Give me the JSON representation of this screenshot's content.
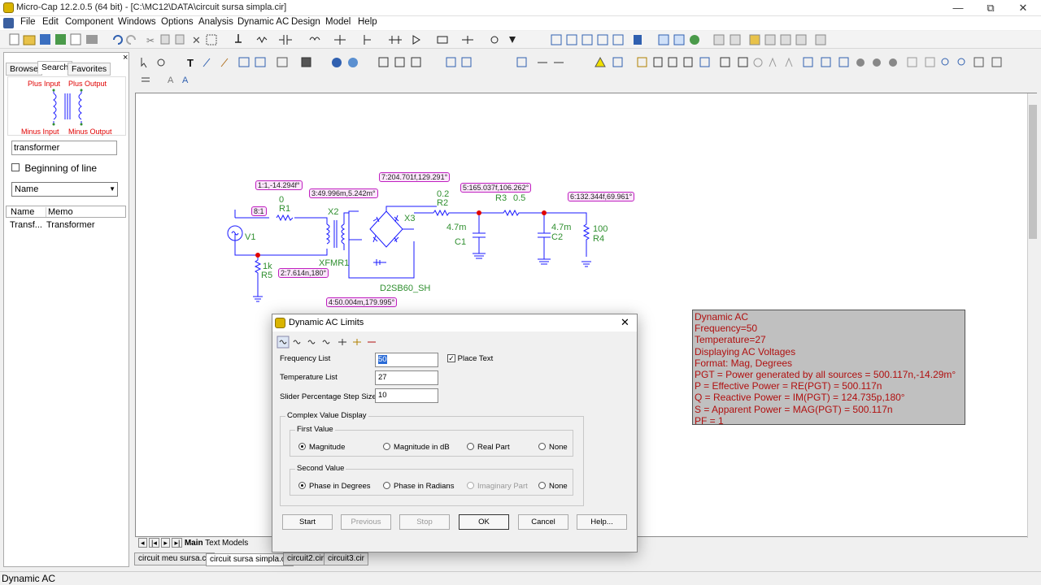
{
  "window": {
    "title": "Micro-Cap 12.2.0.5 (64 bit) - [C:\\MC12\\DATA\\circuit sursa simpla.cir]",
    "controls": [
      "—",
      "⧉",
      "✕"
    ]
  },
  "menu": [
    "File",
    "Edit",
    "Component",
    "Windows",
    "Options",
    "Analysis",
    "Dynamic AC",
    "Design",
    "Model",
    "Help"
  ],
  "panel": {
    "tabs": [
      "Browse",
      "Search",
      "Favorites"
    ],
    "selected_tab": "Search",
    "close": "×",
    "preview_labels": [
      "Plus Input",
      "Plus Output",
      "Minus Input",
      "Minus Output"
    ],
    "search_value": "transformer",
    "beginning_of_line_label": "Beginning of line",
    "filter_select": "Name",
    "columns": [
      "Name",
      "Memo"
    ],
    "rows": [
      {
        "name": "Transf...",
        "memo": "Transformer"
      }
    ]
  },
  "sheet_tabs": [
    "Main",
    "Text",
    "Models"
  ],
  "file_tabs": [
    "circuit meu sursa.cir",
    "circuit sursa simpla.cir",
    "circuit2.cir",
    "circuit3.cir"
  ],
  "selected_file_tab": "circuit sursa simpla.cir",
  "status": "Dynamic AC",
  "schematic": {
    "component_labels": {
      "r1_value": "0",
      "r1": "R1",
      "v1": "V1",
      "x2": "X2",
      "xfmr1": "XFMR1",
      "r5_value": "1k",
      "r5": "R5",
      "x3": "X3",
      "d2sb60": "D2SB60_SH",
      "r2_value": "0.2",
      "r2": "R2",
      "c1_value": "4.7m",
      "c1": "C1",
      "r3": "R3",
      "r3_value": "0.5",
      "c2_value": "4.7m",
      "c2": "C2",
      "r4_value": "100",
      "r4": "R4"
    },
    "node_pills": {
      "n1": "1:1,-14.294f°",
      "n8": "8:1",
      "n3": "3:49.996m,5.242m°",
      "n7": "7:204.701f,129.291°",
      "n5": "5:165.037f,106.262°",
      "n6": "6:132.344f,69.961°",
      "n2": "2:7.614n,180°",
      "n4": "4:50.004m,179.995°"
    }
  },
  "infobox": [
    "Dynamic AC",
    "Frequency=50",
    "Temperature=27",
    "Displaying AC Voltages",
    "Format: Mag, Degrees",
    "PGT = Power generated by all sources = 500.117n,-14.29m°",
    "P = Effective Power = RE(PGT) = 500.117n",
    "Q = Reactive Power = IM(PGT) = 124.735p,180°",
    "S = Apparent Power = MAG(PGT) = 500.117n",
    "PF = 1"
  ],
  "dialog": {
    "title": "Dynamic AC Limits",
    "close": "✕",
    "frequency_list_label": "Frequency List",
    "frequency_list_value": "50",
    "temperature_list_label": "Temperature List",
    "temperature_list_value": "27",
    "slider_step_label": "Slider Percentage Step Size",
    "slider_step_value": "10",
    "place_text_label": "Place Text",
    "complex_group": "Complex Value Display",
    "first_value_group": "First Value",
    "first_options": [
      "Magnitude",
      "Magnitude in dB",
      "Real Part",
      "None"
    ],
    "first_selected": "Magnitude",
    "second_value_group": "Second Value",
    "second_options": [
      "Phase in Degrees",
      "Phase in Radians",
      "Imaginary Part",
      "None"
    ],
    "second_selected": "Phase in Degrees",
    "buttons": [
      "Start",
      "Previous",
      "Stop",
      "OK",
      "Cancel",
      "Help..."
    ]
  },
  "colors": {
    "wire": "#1a1aff",
    "label_green": "#2f8f2f",
    "node_red": "#e00000",
    "pill_border": "#c020c0",
    "infobox_text": "#b01010",
    "infobox_bg": "#c0c0c0"
  }
}
